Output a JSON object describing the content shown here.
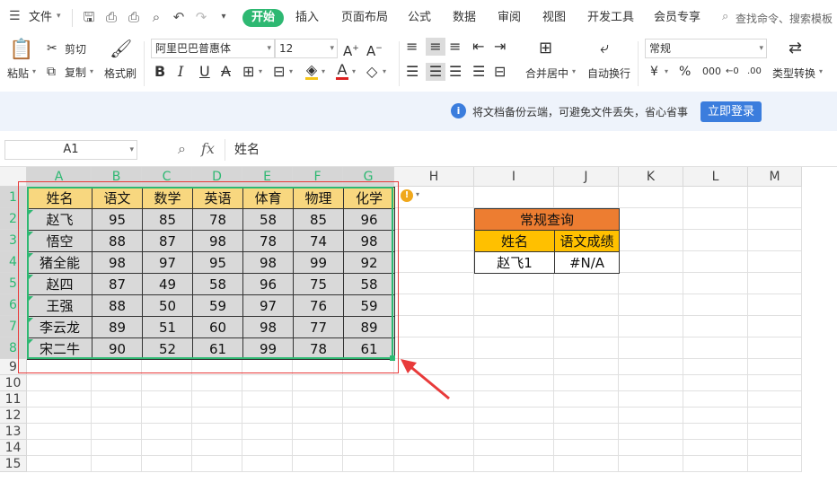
{
  "menubar": {
    "file_label": "文件",
    "tabs": [
      "开始",
      "插入",
      "页面布局",
      "公式",
      "数据",
      "审阅",
      "视图",
      "开发工具",
      "会员专享"
    ],
    "search_placeholder": "查找命令、搜索模板"
  },
  "ribbon": {
    "paste": "粘贴",
    "cut": "剪切",
    "copy": "复制",
    "format_painter": "格式刷",
    "font_name": "阿里巴巴普惠体",
    "font_size": "12",
    "merge_center": "合并居中",
    "wrap_text": "自动换行",
    "number_format": "常规",
    "type_convert": "类型转换",
    "currency_symbol": "¥",
    "percent_symbol": "%"
  },
  "notice": {
    "text": "将文档备份云端，可避免文件丢失，省心省事",
    "login_button": "立即登录"
  },
  "formula_bar": {
    "name_box": "A1",
    "fx": "fx",
    "content": "姓名"
  },
  "columns": [
    "A",
    "B",
    "C",
    "D",
    "E",
    "F",
    "G",
    "H",
    "I",
    "J",
    "K",
    "L",
    "M"
  ],
  "rows": [
    "1",
    "2",
    "3",
    "4",
    "5",
    "6",
    "7",
    "8",
    "9",
    "10",
    "11",
    "12",
    "13",
    "14",
    "15"
  ],
  "table": {
    "headers": [
      "姓名",
      "语文",
      "数学",
      "英语",
      "体育",
      "物理",
      "化学"
    ],
    "rows": [
      [
        "赵飞",
        "95",
        "85",
        "78",
        "58",
        "85",
        "96"
      ],
      [
        "悟空",
        "88",
        "87",
        "98",
        "78",
        "74",
        "98"
      ],
      [
        "猪全能",
        "98",
        "97",
        "95",
        "98",
        "99",
        "92"
      ],
      [
        "赵四",
        "87",
        "49",
        "58",
        "96",
        "75",
        "58"
      ],
      [
        "王强",
        "88",
        "50",
        "59",
        "97",
        "76",
        "59"
      ],
      [
        "李云龙",
        "89",
        "51",
        "60",
        "98",
        "77",
        "89"
      ],
      [
        "宋二牛",
        "90",
        "52",
        "61",
        "99",
        "78",
        "61"
      ]
    ]
  },
  "lookup": {
    "title": "常规查询",
    "col1": "姓名",
    "col2": "语文成绩",
    "name": "赵飞1",
    "result": "#N/A"
  },
  "colors": {
    "accent": "#2eb872",
    "lookup_title": "#ed7d31",
    "lookup_header": "#ffc000",
    "table_header": "#f8d77f",
    "table_body": "#d9d9d9",
    "login_button": "#3b7ddd",
    "annotation": "#e83a3a"
  }
}
